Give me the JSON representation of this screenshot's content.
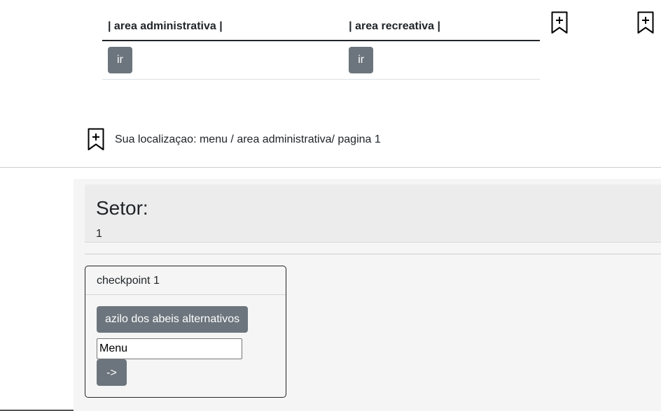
{
  "areas": {
    "headers": [
      "| area administrativa |",
      "| area recreativa |"
    ],
    "buttons": [
      "ir",
      "ir"
    ]
  },
  "icons": [
    "bookmark-plus-icon"
  ],
  "location": {
    "text": "Sua localizaçao: menu / area administrativa/ pagina 1"
  },
  "setor": {
    "title": "Setor:",
    "value": "1"
  },
  "checkpoint": {
    "title": "checkpoint 1",
    "button_label": "azilo dos abeis alternativos",
    "input_value": "Menu",
    "go_label": "->"
  },
  "colors": {
    "button_gray": "#6c757d",
    "panel_bg": "#f5f5f5",
    "header_bg": "#ececec"
  }
}
